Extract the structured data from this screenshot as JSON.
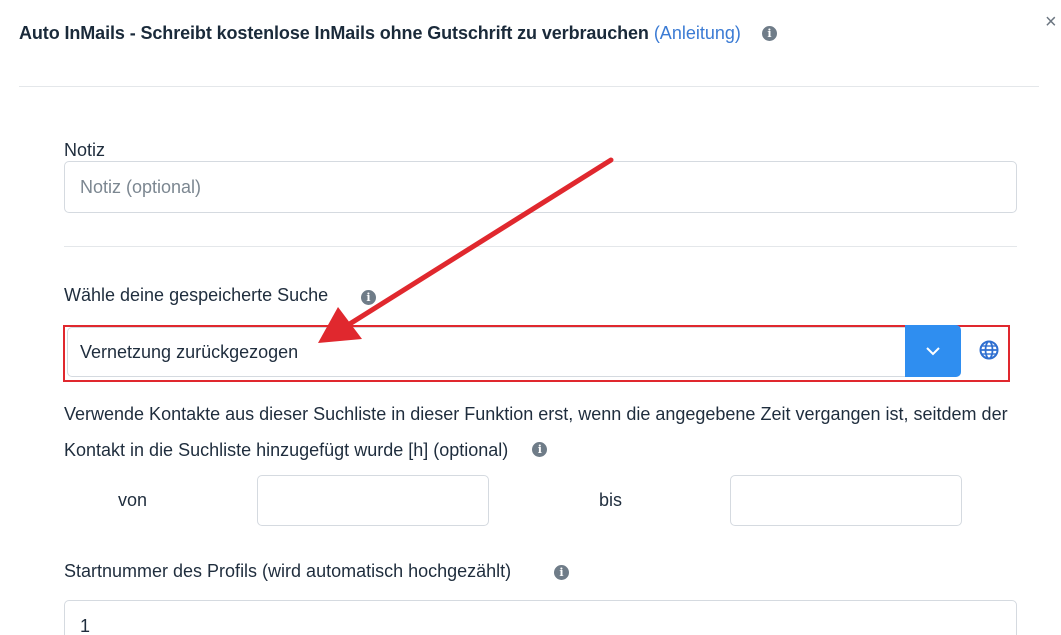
{
  "header": {
    "title": "Auto InMails - Schreibt kostenlose InMails ohne Gutschrift zu verbrauchen",
    "link": "(Anleitung)",
    "info_icon": "info-icon",
    "close": "×"
  },
  "note": {
    "label": "Notiz",
    "placeholder": "Notiz (optional)",
    "value": ""
  },
  "saved_search": {
    "label": "Wähle deine gespeicherte Suche",
    "selected": "Vernetzung zurückgezogen",
    "dropdown_icon": "chevron-down-icon",
    "globe_icon": "globe-icon"
  },
  "time_filter": {
    "description": "Verwende Kontakte aus dieser Suchliste in dieser Funktion erst, wenn die angegebene Zeit vergangen ist, seitdem der Kontakt in die Suchliste hinzugefügt wurde [h] (optional)",
    "from_label": "von",
    "to_label": "bis",
    "from_value": "",
    "to_value": ""
  },
  "start_number": {
    "label": "Startnummer des Profils (wird automatisch hochgezählt)",
    "value": "1"
  },
  "colors": {
    "accent": "#2f8ef0",
    "highlight": "#e0282e",
    "link": "#3b7bd4"
  }
}
